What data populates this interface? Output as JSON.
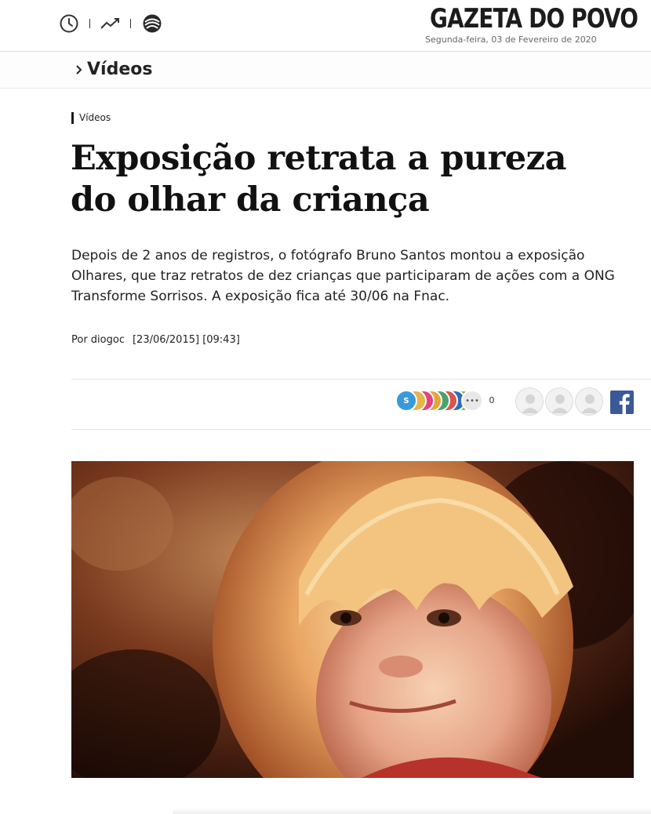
{
  "header": {
    "icons": [
      "clock-icon",
      "trending-icon",
      "gazeta-mark-icon"
    ],
    "logo_text": "GAZETA DO POVO",
    "date_text": "Segunda-feira, 03 de Fevereiro de 2020"
  },
  "section": {
    "title": "Vídeos"
  },
  "article": {
    "category": "Vídeos",
    "headline": "Exposição retrata a pureza do olhar da criança",
    "lead": "Depois de 2 anos de registros, o fotógrafo Bruno Santos montou a exposição Olhares, que traz retratos de dez crianças que participaram de ações com a ONG Transforme Sorrisos. A exposição fica até 30/06 na Fnac.",
    "byline": "Por diogoc",
    "datetime": "[23/06/2015] [09:43]"
  },
  "share": {
    "main_label": "S",
    "more_label": "•••",
    "count": "0",
    "dot_colors": [
      "#e8a33c",
      "#d9534f",
      "#4aa36b",
      "#e0457b",
      "#2f6db5",
      "#7b3fa0",
      "#e34a33",
      "#8fbc3a",
      "#555555"
    ],
    "facebook_icon": "facebook-icon",
    "avatars": [
      "user-avatar-icon",
      "user-avatar-icon",
      "user-avatar-icon"
    ]
  },
  "colors": {
    "share_main": "#3a9ad9",
    "facebook": "#3b5998"
  }
}
